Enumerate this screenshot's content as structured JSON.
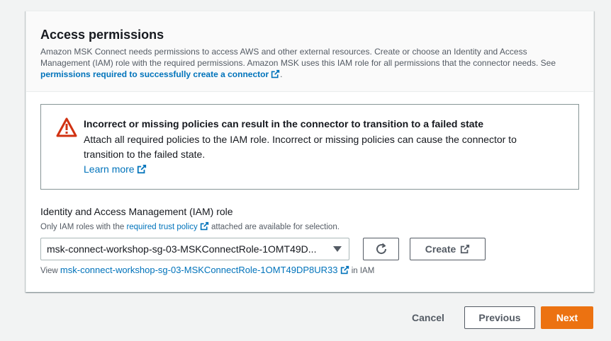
{
  "section": {
    "title": "Access permissions",
    "description_prefix": "Amazon MSK Connect needs permissions to access AWS and other external resources. Create or choose an Identity and Access Management (IAM) role with the required permissions. Amazon MSK uses this IAM role for all permissions that the connector needs. See ",
    "description_link": "permissions required to successfully create a connector",
    "description_suffix": "."
  },
  "alert": {
    "title": "Incorrect or missing policies can result in the connector to transition to a failed state",
    "body": "Attach all required policies to the IAM role. Incorrect or missing policies can cause the connector to transition to the failed state.",
    "link": "Learn more",
    "icon": "warning-icon",
    "color": "#d13212"
  },
  "iam_role": {
    "label": "Identity and Access Management (IAM) role",
    "desc_prefix": "Only IAM roles with the ",
    "desc_link": "required trust policy",
    "desc_suffix": "attached are available for selection.",
    "selected_value": "msk-connect-workshop-sg-03-MSKConnectRole-1OMT49D...",
    "create_label": "Create",
    "view_prefix": "View ",
    "view_link": "msk-connect-workshop-sg-03-MSKConnectRole-1OMT49DP8UR33",
    "view_suffix": " in IAM"
  },
  "footer": {
    "cancel_label": "Cancel",
    "previous_label": "Previous",
    "next_label": "Next",
    "primary_color": "#ec7211"
  }
}
